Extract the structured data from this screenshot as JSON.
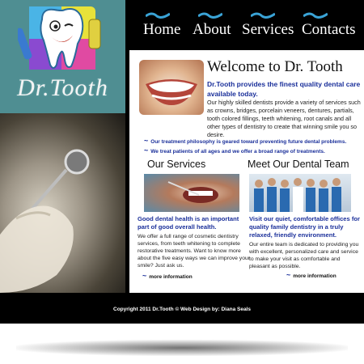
{
  "nav": {
    "items": [
      {
        "label": "Home"
      },
      {
        "label": "About"
      },
      {
        "label": "Services"
      },
      {
        "label": "Contacts"
      }
    ]
  },
  "logo": {
    "text": "Dr.Tooth"
  },
  "welcome": {
    "title": "Welcome to Dr. Tooth",
    "tagline": "Dr.Tooth provides the finest quality dental care available today.",
    "body": "Our highly skilled dentists provide a variety of services such as crowns, bridges, porcelain veneers, dentures, partials, tooth colored fillings, teeth whitening, root canals and all other types of dentistry to create that winning smile you so desire."
  },
  "bullets": [
    "Our treatment philosophy is geared toward preventing future dental problems.",
    "We treat patients of all ages and we offer a broad range of treatments."
  ],
  "services": {
    "title": "Our Services",
    "bold": "Good dental health is an important part of good overall health.",
    "body": "We offer a full range of cosmetic dentistry services, from teeth whitening to complete restorative treatments. Want to know more about the five easy ways we can improve your smile? Just ask us.",
    "more": "more information"
  },
  "team": {
    "title": "Meet Our Dental Team",
    "bold": "Visit our quiet, comfortable offices for quality family dentistry in a truly relaxed, friendly environment.",
    "body": "Our entire team is dedicated to providing you with excellent, personalized care and service to make your visit as comfortable and pleasant as possible.",
    "more": "more information"
  },
  "footer": {
    "text": "Copyright 2011 Dr.Tooth © Web Design by: Diana Seals"
  },
  "colors": {
    "accent_blue": "#1a2f9a",
    "logo_teal": "#4f8e92",
    "frame": "#000000",
    "nav_swoosh": "#3aa3d6"
  }
}
